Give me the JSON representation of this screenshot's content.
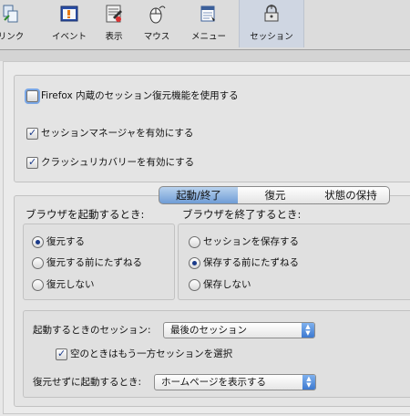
{
  "toolbar": {
    "items": [
      {
        "label": "リンク",
        "icon": "link-icon"
      },
      {
        "label": "イベント",
        "icon": "event-icon"
      },
      {
        "label": "表示",
        "icon": "display-icon"
      },
      {
        "label": "マウス",
        "icon": "mouse-icon"
      },
      {
        "label": "メニュー",
        "icon": "menu-icon"
      },
      {
        "label": "セッション",
        "icon": "session-icon",
        "selected": true
      }
    ]
  },
  "options": {
    "firefox_restore": {
      "label": "Firefox 内蔵のセッション復元機能を使用する",
      "checked": false
    },
    "session_manager": {
      "label": "セッションマネージャを有効にする",
      "checked": true
    },
    "crash_recovery": {
      "label": "クラッシュリカバリーを有効にする",
      "checked": true
    }
  },
  "tabs": [
    {
      "label": "起動/終了",
      "active": true
    },
    {
      "label": "復元",
      "active": false
    },
    {
      "label": "状態の保持",
      "active": false
    }
  ],
  "startup": {
    "heading": "ブラウザを起動するとき:",
    "options": [
      {
        "label": "復元する",
        "selected": true
      },
      {
        "label": "復元する前にたずねる",
        "selected": false
      },
      {
        "label": "復元しない",
        "selected": false
      }
    ]
  },
  "shutdown": {
    "heading": "ブラウザを終了するとき:",
    "options": [
      {
        "label": "セッションを保存する",
        "selected": false
      },
      {
        "label": "保存する前にたずねる",
        "selected": true
      },
      {
        "label": "保存しない",
        "selected": false
      }
    ]
  },
  "startup_session": {
    "label": "起動するときのセッション:",
    "value": "最後のセッション",
    "alt_checkbox": {
      "label": "空のときはもう一方セッションを選択",
      "checked": true
    }
  },
  "no_restore": {
    "label": "復元せずに起動するとき:",
    "value": "ホームページを表示する"
  },
  "colors": {
    "accent": "#3d79d0",
    "selected_tab": "#cfd6e2"
  }
}
